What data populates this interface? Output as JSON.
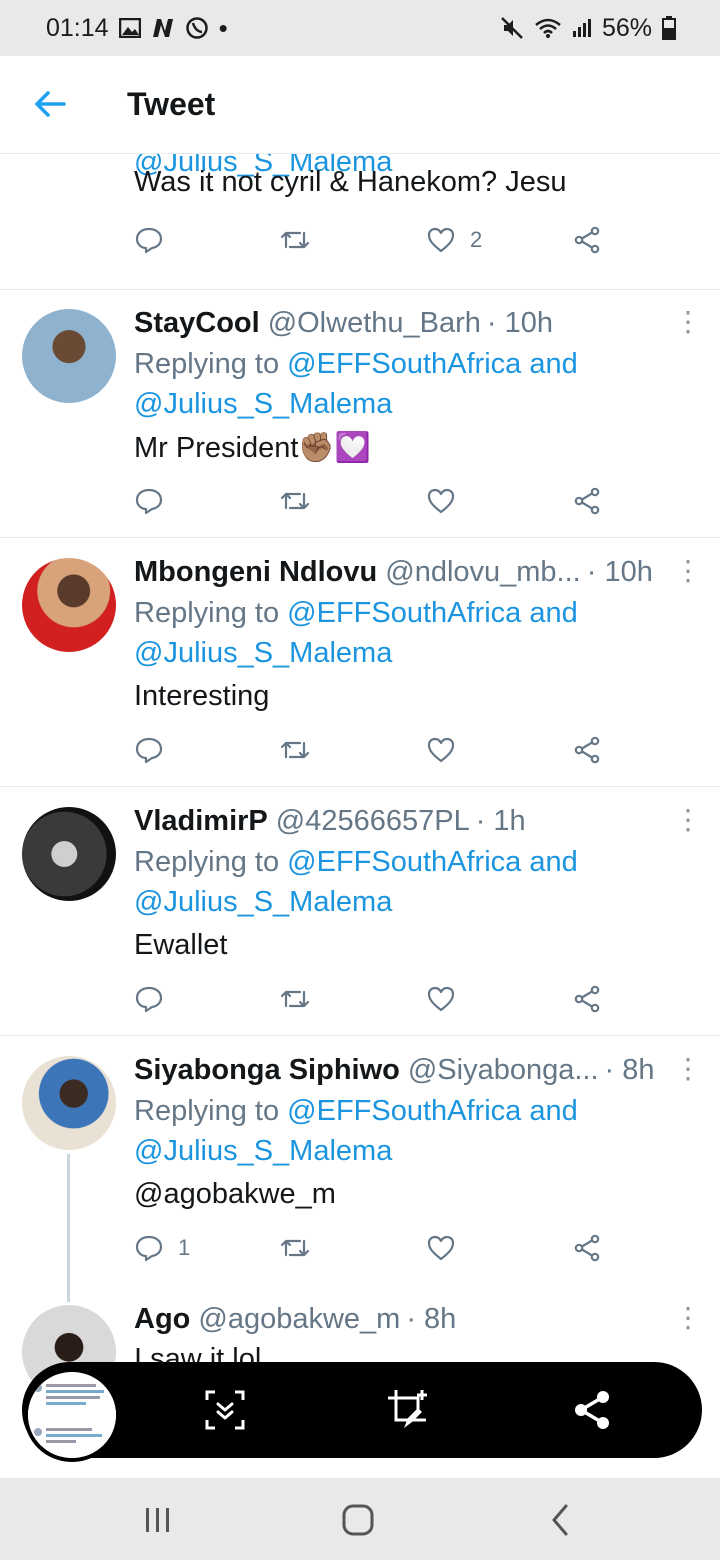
{
  "status_bar": {
    "time": "01:14",
    "left_icons": [
      "gallery-icon",
      "n-notification-icon",
      "whatsapp-icon"
    ],
    "battery": "56%"
  },
  "header": {
    "title": "Tweet"
  },
  "tweets": [
    {
      "reply_prefix": "",
      "reply_mention": "@Julius_S_Malema",
      "text": "Was it not cyril & Hanekom?  Jesu",
      "reply_count": "",
      "like_count": "2"
    },
    {
      "name": "StayCool",
      "handle": "@Olwethu_Barh",
      "time": "· 10h",
      "reply_prefix": "Replying to ",
      "reply_mention_1": "@EFFSouthAfrica",
      "reply_and": " and",
      "reply_mention_2": "@Julius_S_Malema",
      "text": "Mr President✊🏽💟"
    },
    {
      "name": "Mbongeni Ndlovu",
      "handle": "@ndlovu_mb...",
      "time": "· 10h",
      "reply_prefix": "Replying to ",
      "reply_mention_1": "@EFFSouthAfrica",
      "reply_and": " and",
      "reply_mention_2": "@Julius_S_Malema",
      "text": "Interesting"
    },
    {
      "name": "VladimirP",
      "handle": "@42566657PL",
      "time": "· 1h",
      "reply_prefix": "Replying to ",
      "reply_mention_1": "@EFFSouthAfrica",
      "reply_and": " and",
      "reply_mention_2": "@Julius_S_Malema",
      "text": "Ewallet"
    },
    {
      "name": "Siyabonga Siphiwo",
      "handle": "@Siyabonga...",
      "time": "· 8h",
      "reply_prefix": "Replying to ",
      "reply_mention_1": "@EFFSouthAfrica",
      "reply_and": " and",
      "reply_mention_2": "@Julius_S_Malema",
      "text": "@agobakwe_m",
      "reply_count": "1"
    },
    {
      "name": "Ago",
      "handle": "@agobakwe_m",
      "time": "· 8h",
      "text": "I saw it lol"
    }
  ],
  "screenshot_toolbar": {
    "buttons": [
      "scroll-capture-icon",
      "crop-edit-icon",
      "share-icon"
    ]
  },
  "nav_bar": {
    "buttons": [
      "recent-apps-icon",
      "home-icon",
      "back-nav-icon"
    ]
  },
  "colors": {
    "accent": "#1b95e0",
    "secondary_text": "#657786",
    "divider": "#e6ecf0",
    "back_arrow": "#1da1f2"
  }
}
